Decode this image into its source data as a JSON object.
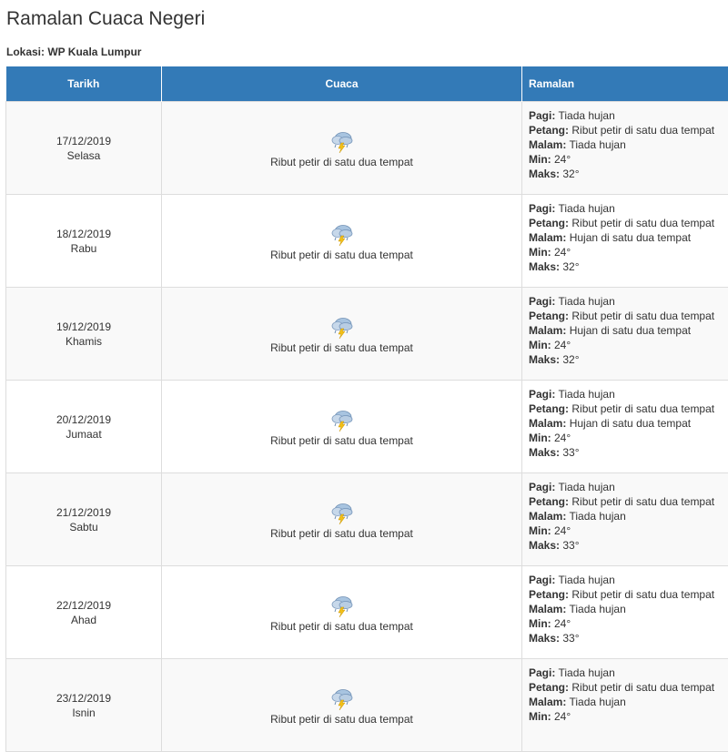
{
  "page": {
    "title": "Ramalan Cuaca Negeri",
    "location_label": "Lokasi:",
    "location_value": "WP Kuala Lumpur"
  },
  "table": {
    "headers": {
      "date": "Tarikh",
      "weather": "Cuaca",
      "forecast": "Ramalan"
    },
    "labels": {
      "morning": "Pagi:",
      "afternoon": "Petang:",
      "night": "Malam:",
      "min": "Min:",
      "max": "Maks:"
    },
    "rows": [
      {
        "date": "17/12/2019",
        "day": "Selasa",
        "weather_icon": "thunderstorm-icon",
        "weather": "Ribut petir di satu dua tempat",
        "morning": "Tiada hujan",
        "afternoon": "Ribut petir di satu dua tempat",
        "night": "Tiada hujan",
        "min": "24°",
        "max": "32°"
      },
      {
        "date": "18/12/2019",
        "day": "Rabu",
        "weather_icon": "thunderstorm-icon",
        "weather": "Ribut petir di satu dua tempat",
        "morning": "Tiada hujan",
        "afternoon": "Ribut petir di satu dua tempat",
        "night": "Hujan di satu dua tempat",
        "min": "24°",
        "max": "32°"
      },
      {
        "date": "19/12/2019",
        "day": "Khamis",
        "weather_icon": "thunderstorm-icon",
        "weather": "Ribut petir di satu dua tempat",
        "morning": "Tiada hujan",
        "afternoon": "Ribut petir di satu dua tempat",
        "night": "Hujan di satu dua tempat",
        "min": "24°",
        "max": "32°"
      },
      {
        "date": "20/12/2019",
        "day": "Jumaat",
        "weather_icon": "thunderstorm-icon",
        "weather": "Ribut petir di satu dua tempat",
        "morning": "Tiada hujan",
        "afternoon": "Ribut petir di satu dua tempat",
        "night": "Hujan di satu dua tempat",
        "min": "24°",
        "max": "33°"
      },
      {
        "date": "21/12/2019",
        "day": "Sabtu",
        "weather_icon": "thunderstorm-icon",
        "weather": "Ribut petir di satu dua tempat",
        "morning": "Tiada hujan",
        "afternoon": "Ribut petir di satu dua tempat",
        "night": "Tiada hujan",
        "min": "24°",
        "max": "33°"
      },
      {
        "date": "22/12/2019",
        "day": "Ahad",
        "weather_icon": "thunderstorm-icon",
        "weather": "Ribut petir di satu dua tempat",
        "morning": "Tiada hujan",
        "afternoon": "Ribut petir di satu dua tempat",
        "night": "Tiada hujan",
        "min": "24°",
        "max": "33°"
      },
      {
        "date": "23/12/2019",
        "day": "Isnin",
        "weather_icon": "thunderstorm-icon",
        "weather": "Ribut petir di satu dua tempat",
        "morning": "Tiada hujan",
        "afternoon": "Ribut petir di satu dua tempat",
        "night": "Tiada hujan",
        "min": "24°",
        "max": ""
      }
    ]
  },
  "colors": {
    "header_bg": "#337ab7",
    "header_text": "#ffffff",
    "stripe": "#f9f9f9",
    "border": "#dddddd"
  }
}
